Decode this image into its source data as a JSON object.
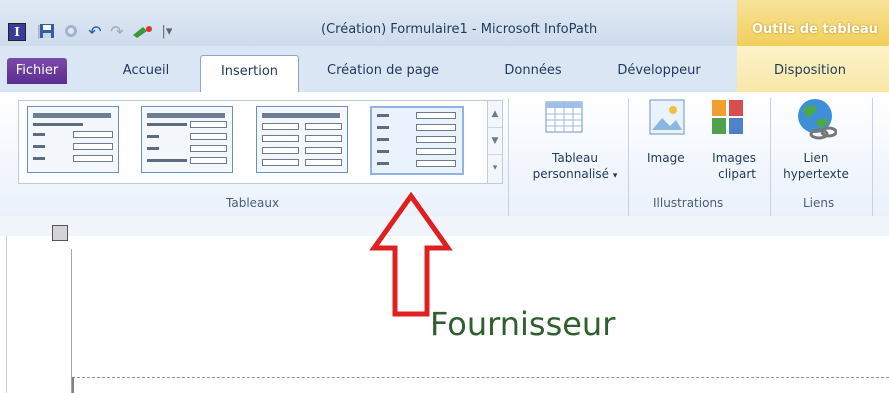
{
  "window": {
    "title": "(Création) Formulaire1 - Microsoft InfoPath",
    "contextual_group": "Outils de tableau"
  },
  "tabs": [
    "Fichier",
    "Accueil",
    "Insertion",
    "Création de page",
    "Données",
    "Développeur",
    "Disposition"
  ],
  "active_tab": "Insertion",
  "ribbon": {
    "groups": {
      "tableaux": "Tableaux",
      "illustrations": "Illustrations",
      "liens": "Liens"
    },
    "buttons": {
      "custom_table_l1": "Tableau",
      "custom_table_l2": "personnalisé",
      "image": "Image",
      "clipart_l1": "Images",
      "clipart_l2": "clipart",
      "link_l1": "Lien",
      "link_l2": "hypertexte"
    }
  },
  "form": {
    "heading": "Fournisseur"
  },
  "colors": {
    "accent_file_tab": "#5c2d91",
    "contextual_tab": "#f2cf5b",
    "annotation_arrow": "#e02020",
    "heading": "#2f5f2f"
  }
}
